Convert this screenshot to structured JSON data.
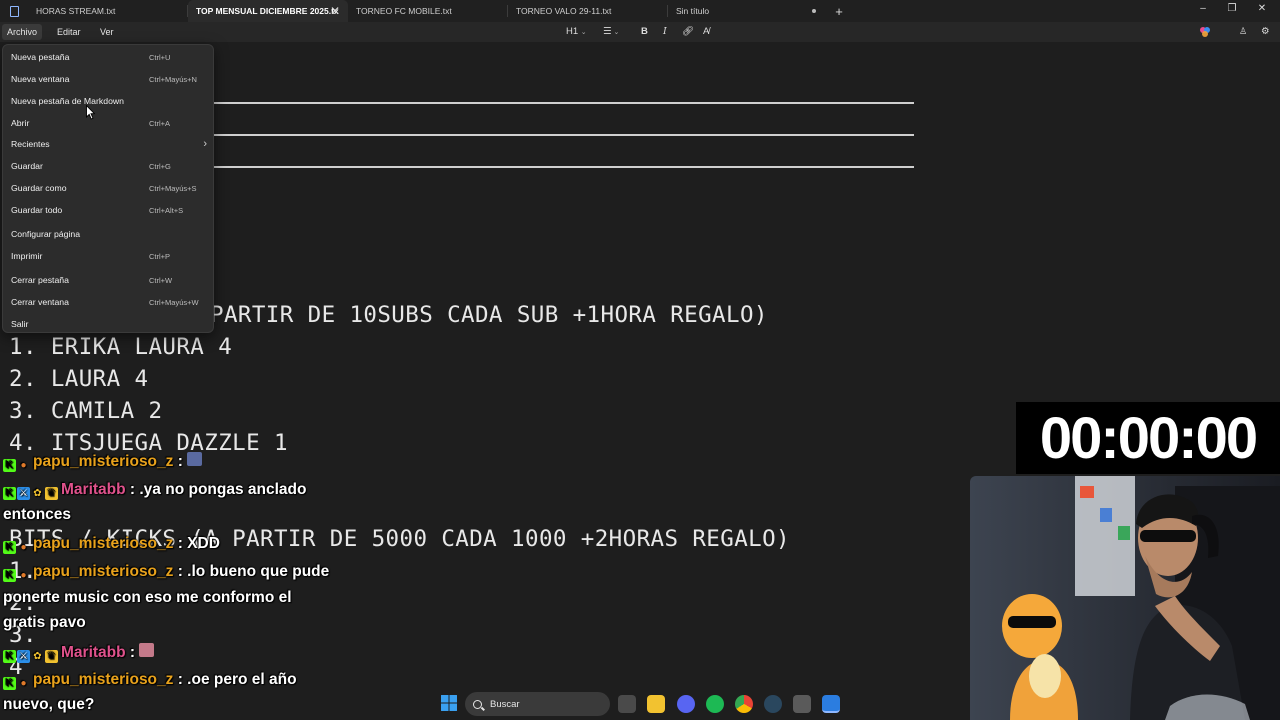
{
  "tabs": [
    {
      "label": "HORAS STREAM.txt",
      "active": false
    },
    {
      "label": "TOP MENSUAL DICIEMBRE 2025.tx",
      "active": true
    },
    {
      "label": "TORNEO FC MOBILE.txt",
      "active": false
    },
    {
      "label": "TORNEO VALO 29-11.txt",
      "active": false
    },
    {
      "label": "Sin título",
      "active": false
    }
  ],
  "window_controls": {
    "minimize": "–",
    "maximize": "❐",
    "close": "✕"
  },
  "menubar": {
    "archivo": "Archivo",
    "editar": "Editar",
    "ver": "Ver"
  },
  "toolbar": {
    "heading": "H1",
    "bold": "B",
    "italic": "I"
  },
  "file_menu": [
    {
      "label": "Nueva pestaña",
      "shortcut": "Ctrl+U"
    },
    {
      "label": "Nueva ventana",
      "shortcut": "Ctrl+Mayús+N"
    },
    {
      "label": "Nueva pestaña de Markdown",
      "shortcut": ""
    },
    {
      "label": "Abrir",
      "shortcut": "Ctrl+A"
    },
    {
      "label": "Recientes",
      "shortcut": ""
    },
    {
      "label": "Guardar",
      "shortcut": "Ctrl+G"
    },
    {
      "label": "Guardar como",
      "shortcut": "Ctrl+Mayús+S"
    },
    {
      "label": "Guardar todo",
      "shortcut": "Ctrl+Alt+S"
    },
    {
      "label": "Configurar página",
      "shortcut": ""
    },
    {
      "label": "Imprimir",
      "shortcut": "Ctrl+P"
    },
    {
      "label": "Cerrar pestaña",
      "shortcut": "Ctrl+W"
    },
    {
      "label": "Cerrar ventana",
      "shortcut": "Ctrl+Mayús+W"
    },
    {
      "label": "Salir",
      "shortcut": ""
    }
  ],
  "document": {
    "subs_header": "PARTIR DE 10SUBS CADA SUB +1HORA REGALO)",
    "subs_list": [
      "1. ERIKA LAURA 4",
      "2. LAURA 4",
      "3. CAMILA 2",
      "4. ITSJUEGA DAZZLE 1"
    ],
    "bits_header": "BITS / KICKS (A PARTIR DE 5000 CADA 1000 +2HORAS REGALO)",
    "bits_list": [
      "1.",
      "2.",
      "3.",
      "4"
    ]
  },
  "timer": "00:00:00",
  "chat": [
    {
      "user": "papu_misterioso_z",
      "color": "#e8a21c",
      "message": ":"
    },
    {
      "user": "Maritabb",
      "color": "#e0528c",
      "message": ": .ya no pongas anclado"
    },
    {
      "user": "",
      "color": "",
      "message": "entonces"
    },
    {
      "user": "papu_misterioso_z",
      "color": "#e8a21c",
      "message": ": XDD"
    },
    {
      "user": "papu_misterioso_z",
      "color": "#e8a21c",
      "message": ": .lo bueno que pude"
    },
    {
      "user": "",
      "color": "",
      "message": "ponerte music con eso me conformo el"
    },
    {
      "user": "",
      "color": "",
      "message": "gratis pavo"
    },
    {
      "user": "Maritabb",
      "color": "#e0528c",
      "message": ":"
    },
    {
      "user": "papu_misterioso_z",
      "color": "#e8a21c",
      "message": ": .oe pero el año"
    },
    {
      "user": "",
      "color": "",
      "message": "nuevo, que?"
    }
  ],
  "taskbar": {
    "search_placeholder": "Buscar"
  },
  "colors": {
    "editor_bg": "#1e1e1e",
    "menu_bg": "#2c2c2c",
    "accent": "#0078d4"
  },
  "icons": [
    "notepad-icon",
    "close-icon",
    "plus-icon",
    "bold-icon",
    "italic-icon",
    "link-icon",
    "clear-format-icon",
    "list-icon",
    "copilot-icon",
    "settings-icon",
    "chevron-right-icon",
    "windows-start-icon",
    "search-icon",
    "file-explorer-icon",
    "discord-icon",
    "spotify-icon",
    "chrome-icon",
    "steam-icon",
    "calculator-icon"
  ]
}
